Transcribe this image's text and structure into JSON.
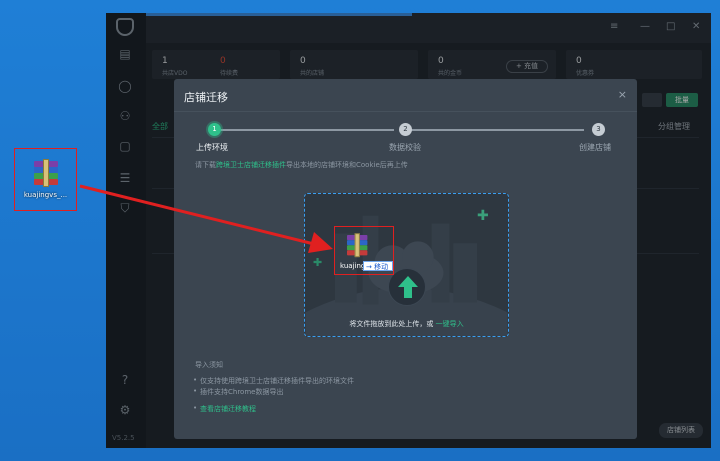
{
  "desktop": {
    "file_name": "kuajingvs_..."
  },
  "app": {
    "version": "V5.2.5",
    "stats": [
      {
        "num": "1",
        "label": "共店VDO",
        "red": false
      },
      {
        "num": "0",
        "label": "待续费",
        "red": true
      },
      {
        "num": "0",
        "label": "共的店铺",
        "red": false
      },
      {
        "num": "0",
        "label": "共的金币",
        "red": false
      },
      {
        "num": "0",
        "label": "优惠券",
        "red": false
      }
    ],
    "topup_label": "+ 充值",
    "tab_all": "全部",
    "tab_group": "分组管理",
    "batch_label": "批量",
    "bottom_button": "店铺列表"
  },
  "modal": {
    "title": "店铺迁移",
    "close": "×",
    "steps": [
      {
        "n": "1",
        "label": "上传环境",
        "active": true
      },
      {
        "n": "2",
        "label": "数据校验",
        "active": false
      },
      {
        "n": "3",
        "label": "创建店铺",
        "active": false
      }
    ],
    "hint_prefix": "请下载",
    "hint_link": "跨境卫士店铺迁移插件",
    "hint_suffix": "导出本地的店铺环境和Cookie后再上传",
    "dropzone_text": "将文件拖放到此处上传，或",
    "dropzone_link": "一键导入",
    "drag_name": "kuajing",
    "move_tag": "→ 移动",
    "notes_title": "导入须知",
    "notes": [
      "仅支持使用跨境卫士店铺迁移插件导出的环境文件",
      "插件支持Chrome数据导出"
    ],
    "notes_link": "查看店铺迁移教程"
  },
  "colors": {
    "accent": "#2fc08b",
    "annotation": "#e02020",
    "dropzone_border": "#3a9ef0"
  },
  "icons": [
    "shield-logo-icon",
    "store-icon",
    "user-icon",
    "users-icon",
    "vip-icon",
    "list-icon",
    "shield-icon",
    "help-icon",
    "settings-icon",
    "upload-arrow-icon",
    "rar-archive-icon"
  ]
}
